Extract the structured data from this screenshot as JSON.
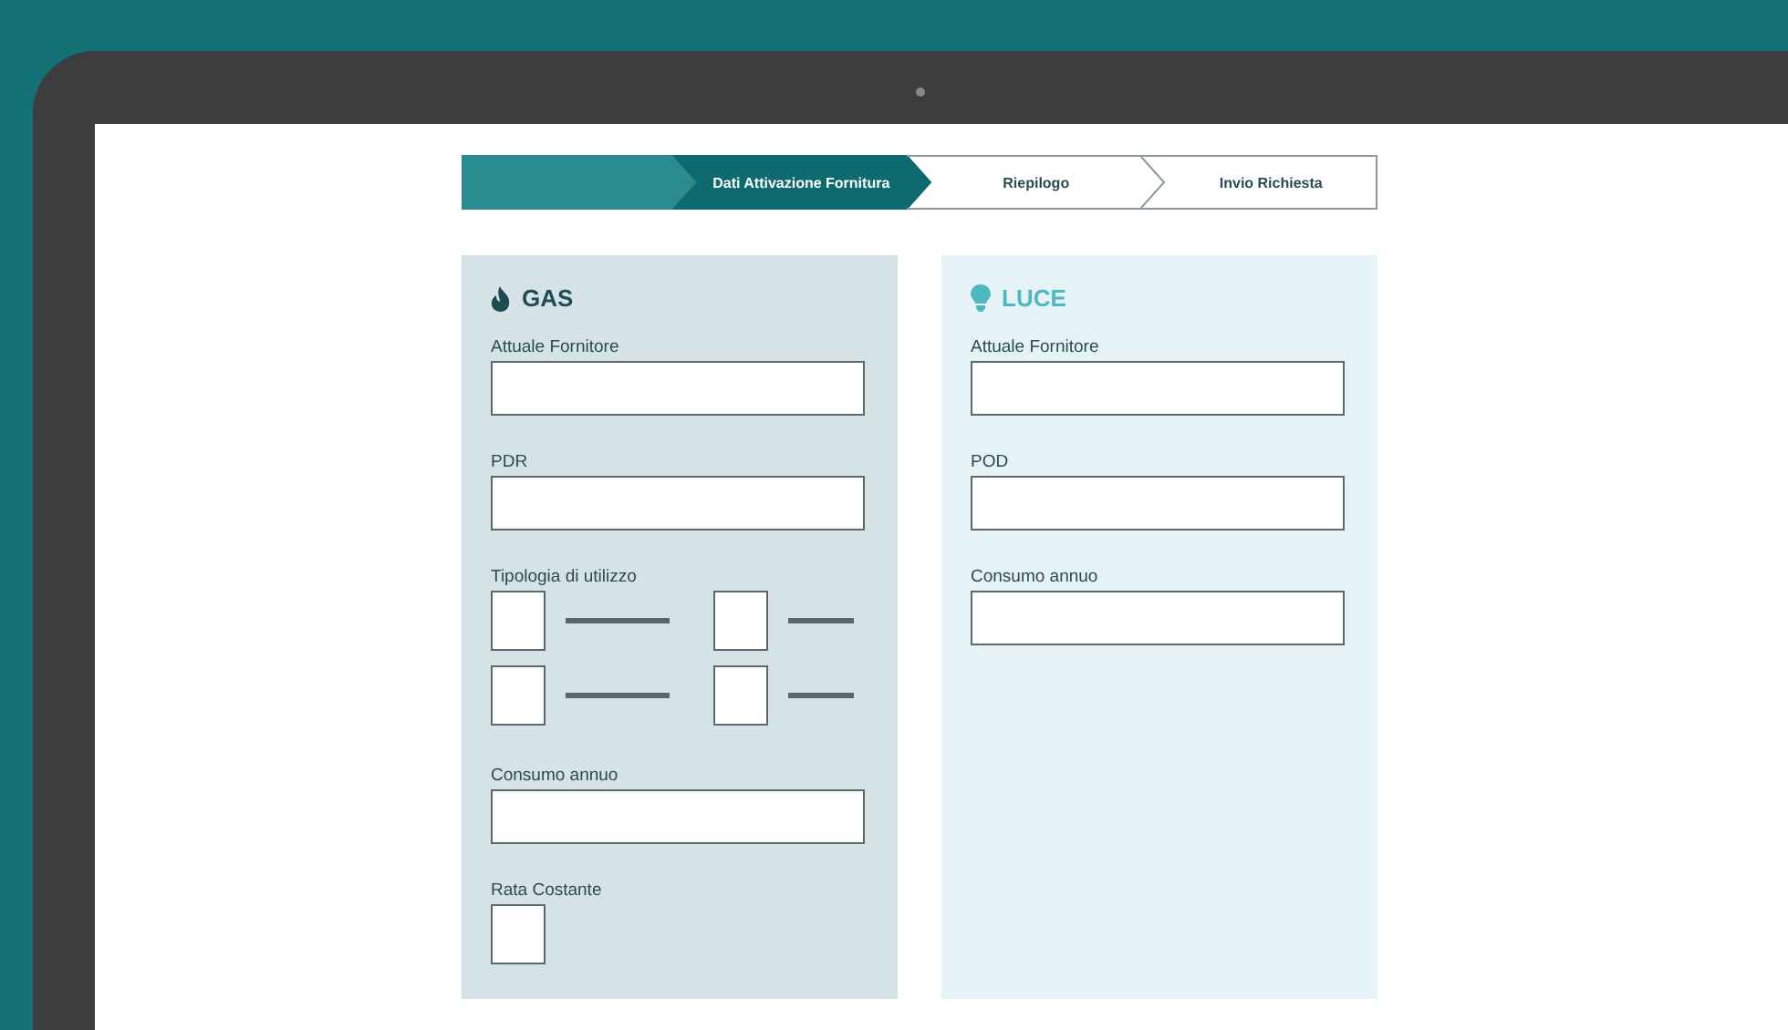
{
  "steps": [
    {
      "completed": true,
      "selected": false
    },
    {
      "label": "Dati Attivazione Fornitura",
      "completed": false,
      "selected": true
    },
    {
      "label": "Riepilogo",
      "completed": false,
      "selected": false
    },
    {
      "label": "Invio Richiesta",
      "completed": false,
      "selected": false
    }
  ],
  "panels": [
    {
      "kind": "gas",
      "title": "GAS",
      "items": [
        {
          "kind": "field",
          "label": "Attuale Fornitore"
        },
        {
          "kind": "field",
          "label": "PDR"
        },
        {
          "kind": "options",
          "label": "Tipologia di utilizzo",
          "options": [
            {
              "checked": false
            },
            {
              "checked": false
            },
            {
              "checked": false
            },
            {
              "checked": false
            }
          ]
        },
        {
          "kind": "field",
          "label": "Consumo annuo"
        },
        {
          "kind": "checkbox",
          "label": "Rata Costante",
          "checked": false
        }
      ]
    },
    {
      "kind": "luce",
      "title": "LUCE",
      "items": [
        {
          "kind": "field",
          "label": "Attuale Fornitore"
        },
        {
          "kind": "field",
          "label": "POD"
        },
        {
          "kind": "field",
          "label": "Consumo annuo"
        }
      ]
    }
  ]
}
